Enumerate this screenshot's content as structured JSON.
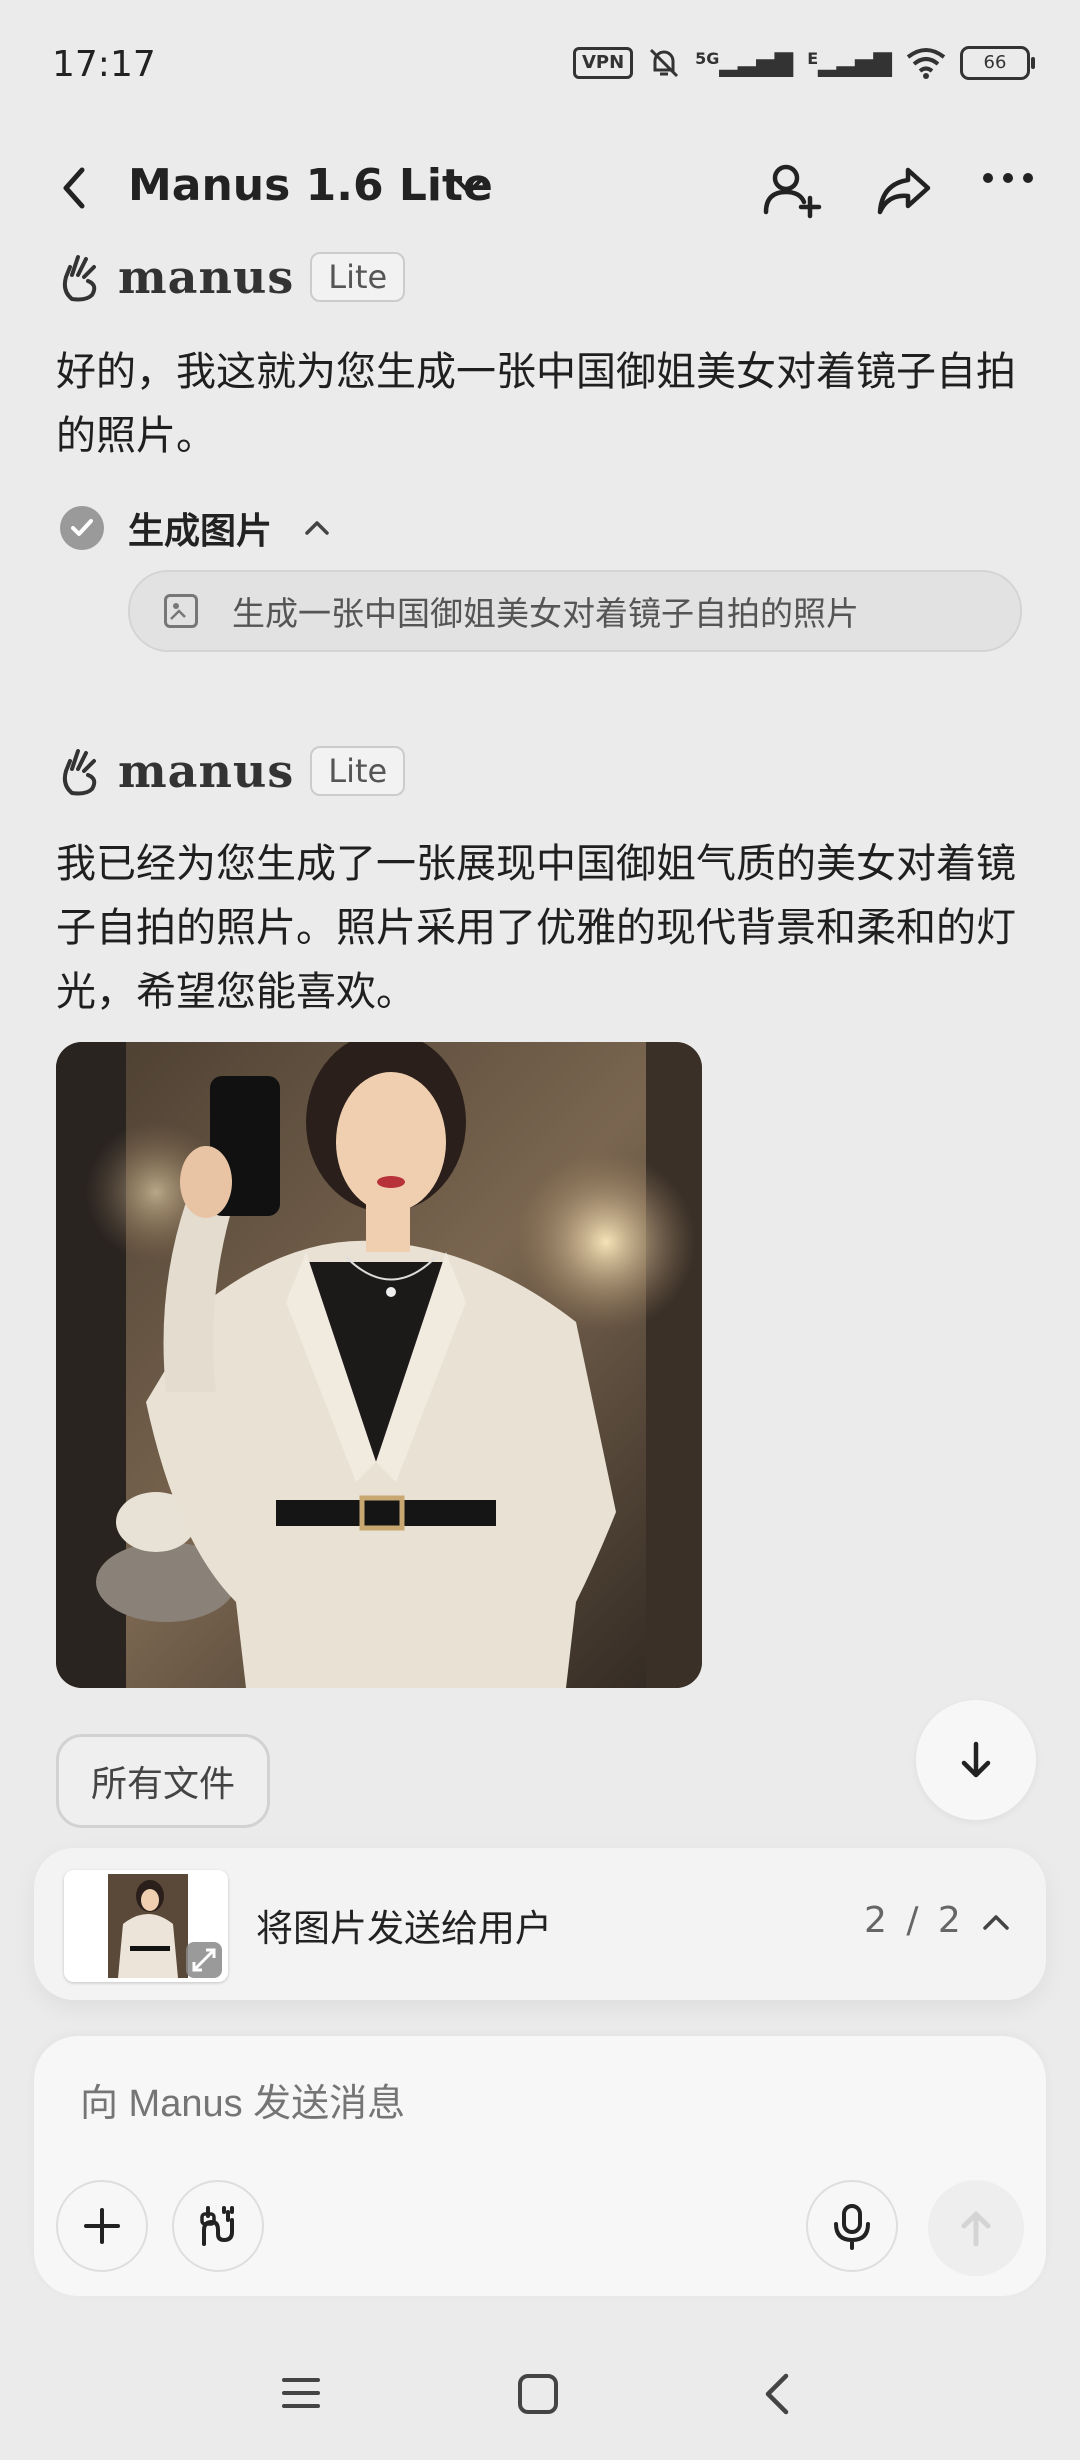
{
  "status_bar": {
    "time": "17:17",
    "vpn": "VPN",
    "network1": "5G",
    "network2": "E",
    "battery": "66"
  },
  "header": {
    "title": "Manus 1.6 Lite"
  },
  "messages": [
    {
      "brand": "manus",
      "badge": "Lite",
      "text": "好的，我这就为您生成一张中国御姐美女对着镜子自拍的照片。",
      "tool": {
        "title": "生成图片",
        "chip": "生成一张中国御姐美女对着镜子自拍的照片"
      }
    },
    {
      "brand": "manus",
      "badge": "Lite",
      "text": "我已经为您生成了一张展现中国御姐气质的美女对着镜子自拍的照片。照片采用了优雅的现代背景和柔和的灯光，希望您能喜欢。"
    }
  ],
  "files_button": "所有文件",
  "task": {
    "text": "将图片发送给用户",
    "count": "2 / 2"
  },
  "composer": {
    "placeholder": "向 Manus 发送消息"
  }
}
